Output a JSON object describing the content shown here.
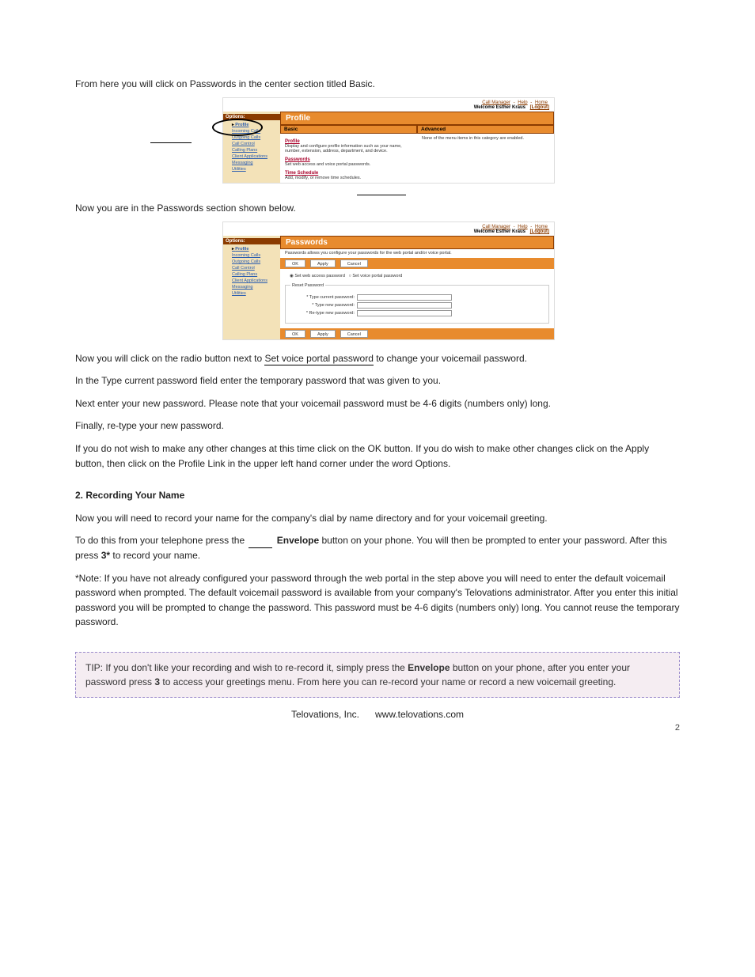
{
  "intro_text": "From here you will click on Passwords in the center section titled Basic.",
  "top_links": {
    "call_manager": "Call Manager",
    "help": "Help",
    "home": "Home"
  },
  "welcome": {
    "prefix": "Welcome",
    "user": "Esther Kraus",
    "logout": "[Logout]"
  },
  "sidebar": {
    "title": "Options:",
    "items": [
      "Profile",
      "Incoming Calls",
      "Outgoing Calls",
      "Call Control",
      "Calling Plans",
      "Client Applications",
      "Messaging",
      "Utilities"
    ]
  },
  "profile_screen": {
    "title": "Profile",
    "basic_head": "Basic",
    "advanced_head": "Advanced",
    "advanced_note": "None of the menu items in this category are enabled.",
    "items": [
      {
        "head": "Profile",
        "desc": "Display and configure profile information such as your name, number, extension, address, department, and device."
      },
      {
        "head": "Passwords",
        "desc": "Set web access and voice portal passwords."
      },
      {
        "head": "Time Schedule",
        "desc": "Add, modify, or remove time schedules."
      }
    ]
  },
  "mid_text": "Now you are in the Passwords section shown below.",
  "passwords_screen": {
    "title": "Passwords",
    "subtitle": "Passwords allows you configure your passwords for the web portal and/or voice portal.",
    "ok": "OK",
    "apply": "Apply",
    "cancel": "Cancel",
    "radio_web": "Set web access password",
    "radio_voice": "Set voice portal password",
    "legend": "Reset Password",
    "f_current": "* Type current password:",
    "f_new": "* Type new password:",
    "f_retype": "* Re-type new password:"
  },
  "step_text_a": "Now you will click on the radio button next to ",
  "step_emph": "Set voice portal password",
  "step_text_b": " to change your voicemail password.",
  "steps": [
    "In the Type current password field enter the temporary password that was given to you.",
    "Next enter your new password. Please note that your voicemail password must be 4-6 digits (numbers only) long.",
    "Finally, re-type your new password.",
    "If you do not wish to make any other changes at this time click on the OK button. If you do wish to make other changes click on the Apply button, then click on the Profile Link in the upper left hand corner under the word Options."
  ],
  "section2": {
    "h": "2. Recording Your Name",
    "p_a": "Now you will need to record your name for the company's dial by name directory and for your voicemail greeting.",
    "p_b_1": "To do this from your telephone press the ",
    "p_b_envelope": "Envelope",
    "p_b_2": " button on your phone. You will then be prompted to enter your password. After this press ",
    "p_b_3_star": "3*",
    "p_b_3": " to record your name.",
    "note_1": "*Note: If you have not already configured your password through the web portal in the step above you will need to enter the default voicemail password when prompted. The default voicemail password is available from your company's Telovations administrator. After you enter this initial password you will be prompted to change the password. This password must be 4-6 digits (numbers only) long. You cannot reuse the temporary password."
  },
  "purple_box": {
    "text_a": "TIP: If you don't like your recording and wish to re-record it, simply press the ",
    "text_env": "Envelope",
    "text_b": " button on your phone, after you enter your password press ",
    "text_3": "3",
    "text_c": " to access your greetings menu. From here you can re-record your name or record a new voicemail greeting."
  },
  "footer": {
    "company": "Telovations, Inc.",
    "url": "www.telovations.com",
    "page": "2"
  }
}
